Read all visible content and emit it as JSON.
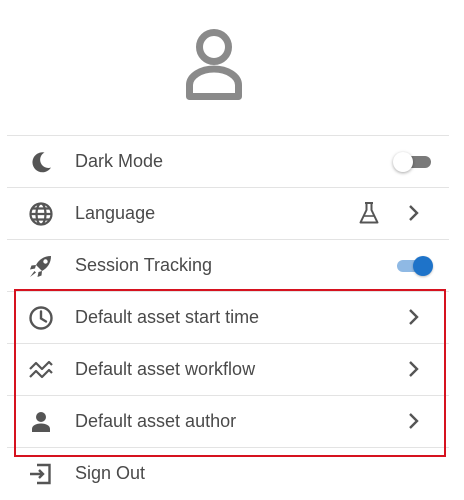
{
  "header": {
    "avatar_icon": "person-icon"
  },
  "menu": {
    "items": [
      {
        "label": "Dark Mode",
        "icon": "moon-icon",
        "control": "toggle",
        "toggled": false
      },
      {
        "label": "Language",
        "icon": "globe-icon",
        "control": "chevron",
        "badge_icon": "flask-icon"
      },
      {
        "label": "Session Tracking",
        "icon": "rocket-icon",
        "control": "toggle",
        "toggled": true
      },
      {
        "label": "Default asset start time",
        "icon": "clock-icon",
        "control": "chevron"
      },
      {
        "label": "Default asset workflow",
        "icon": "workflow-icon",
        "control": "chevron"
      },
      {
        "label": "Default asset author",
        "icon": "person-icon",
        "control": "chevron"
      },
      {
        "label": "Sign Out",
        "icon": "sign-out-icon",
        "control": "none"
      }
    ]
  },
  "colors": {
    "text": "#4a4a4a",
    "icon": "#555555",
    "toggle_on_knob": "#1e73c9",
    "toggle_on_track": "#8fb9e4",
    "highlight": "#d6121f"
  }
}
